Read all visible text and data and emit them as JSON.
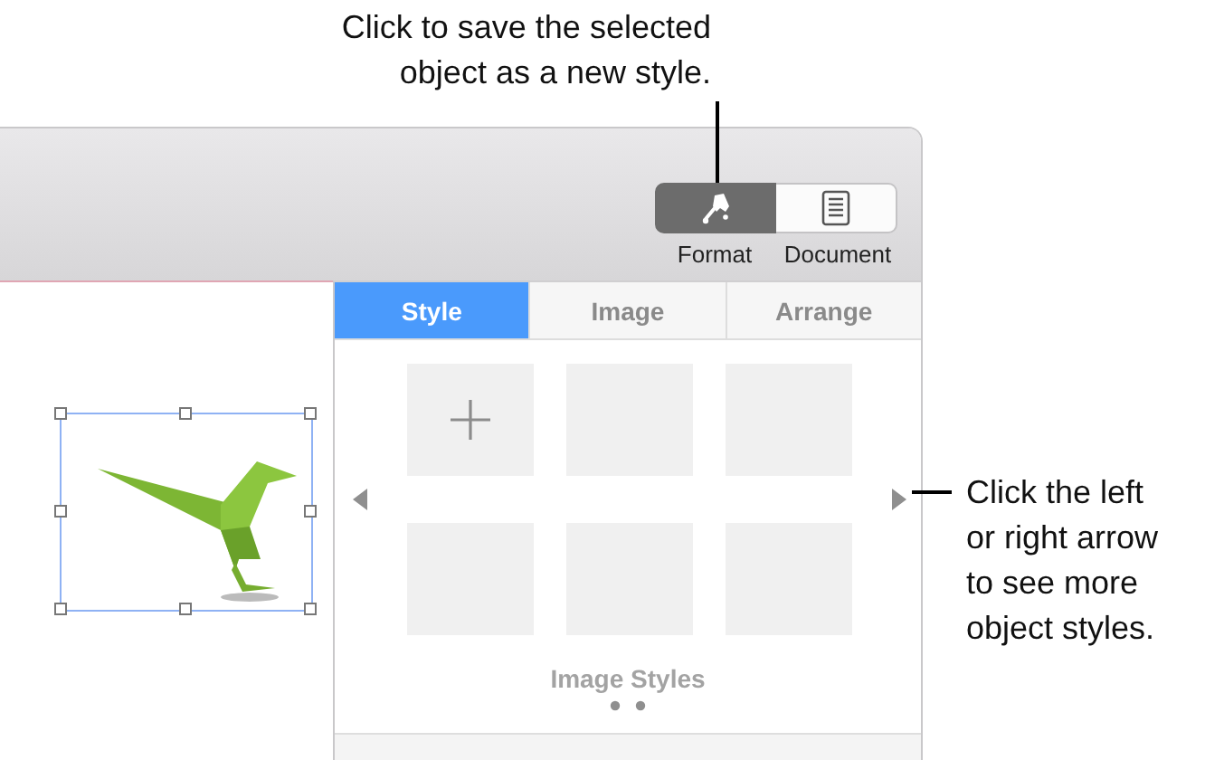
{
  "callouts": [
    {
      "kind": "top",
      "text": "Click to save the selected object as a new style."
    },
    {
      "kind": "right",
      "text": "Click the left or right arrow to see more object styles."
    }
  ],
  "toolbar": {
    "buttons": [
      {
        "kind": "format",
        "label": "Format",
        "selected": true
      },
      {
        "kind": "document",
        "label": "Document",
        "selected": false
      }
    ]
  },
  "canvas": {
    "image": {
      "selected": true
    }
  },
  "inspector": {
    "tabs": [
      {
        "label": "Style",
        "selected": true
      },
      {
        "label": "Image",
        "selected": false
      },
      {
        "label": "Arrange",
        "selected": false
      }
    ],
    "style_tiles": [
      {
        "kind": "add"
      },
      {
        "kind": "empty"
      },
      {
        "kind": "empty"
      },
      {
        "kind": "empty"
      },
      {
        "kind": "empty"
      },
      {
        "kind": "empty"
      }
    ],
    "section_label": "Image Styles"
  }
}
